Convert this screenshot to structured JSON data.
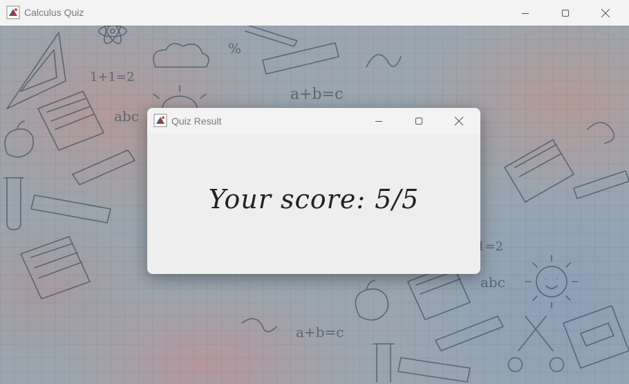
{
  "main_window": {
    "title": "Calculus Quiz",
    "icon": "java-app-icon",
    "controls": [
      "minimize-icon",
      "maximize-icon",
      "close-icon"
    ],
    "background_doodles": [
      "1+1=2",
      "a+b=c",
      "abc",
      "%",
      "1=2",
      "a+b=c",
      "abc"
    ]
  },
  "dialog": {
    "title": "Quiz Result",
    "icon": "java-app-icon",
    "controls": [
      "minimize-icon",
      "maximize-icon",
      "close-icon"
    ],
    "score_label": "Your score: 5/5"
  },
  "colors": {
    "titlebar": "#f3f3f3",
    "title_text": "#7a7a7a",
    "dialog_bg": "#eeeeee",
    "score_text": "#222222"
  }
}
